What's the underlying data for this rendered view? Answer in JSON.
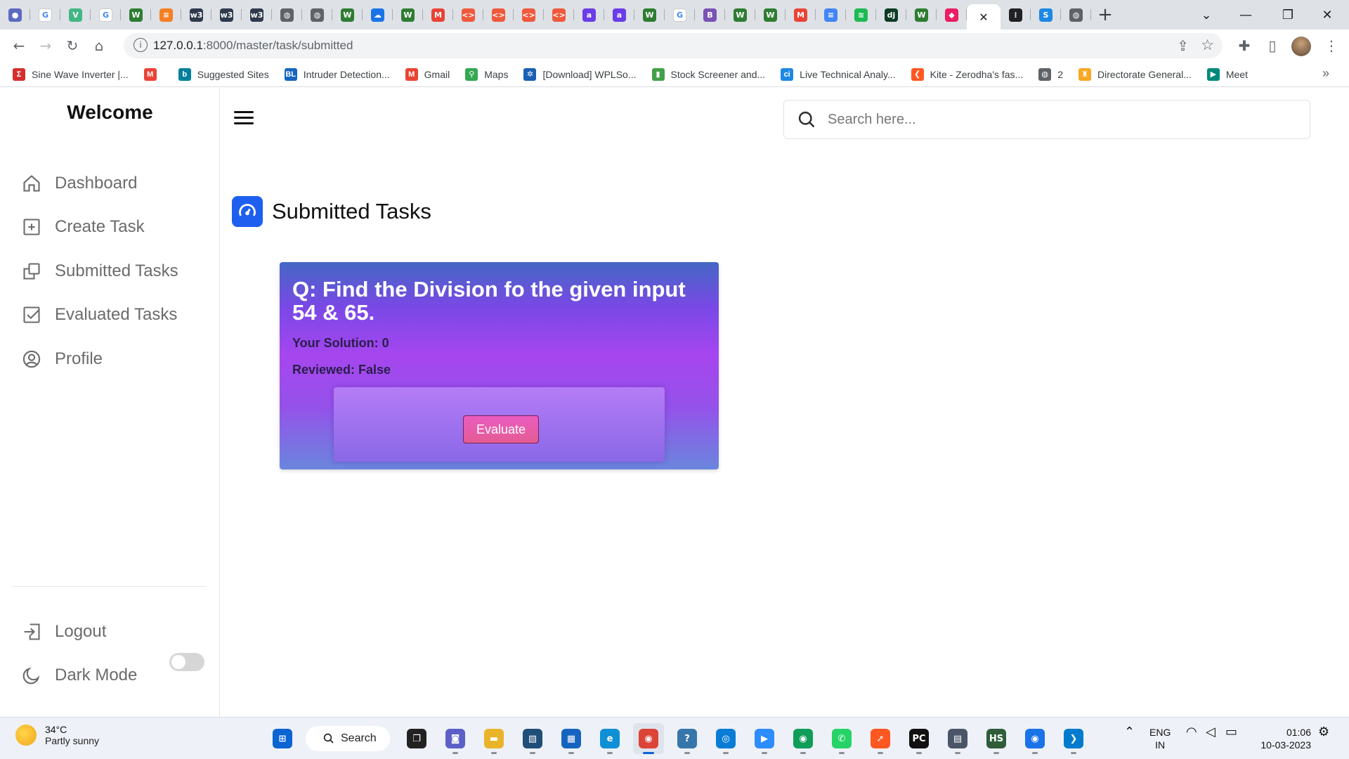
{
  "browser": {
    "url_host": "127.0.0.1",
    "url_rest": ":8000/master/task/submitted",
    "tabs": [
      {
        "icon": "dot",
        "color": "#5c6bc0",
        "glyph": "●"
      },
      {
        "icon": "google-icon",
        "color": "#ffffff",
        "glyph": "G"
      },
      {
        "icon": "vue-icon",
        "color": "#41b883",
        "glyph": "V"
      },
      {
        "icon": "google-icon",
        "color": "#ffffff",
        "glyph": "G"
      },
      {
        "icon": "w-icon",
        "color": "#2e7d32",
        "glyph": "W"
      },
      {
        "icon": "stack-icon",
        "color": "#f48024",
        "glyph": "≡"
      },
      {
        "icon": "w3-icon",
        "color": "#2f3b4c",
        "glyph": "w3"
      },
      {
        "icon": "w3-icon",
        "color": "#2f3b4c",
        "glyph": "w3"
      },
      {
        "icon": "w3-icon",
        "color": "#2f3b4c",
        "glyph": "w3"
      },
      {
        "icon": "globe-icon",
        "color": "#5f6368",
        "glyph": "◍"
      },
      {
        "icon": "globe-icon",
        "color": "#5f6368",
        "glyph": "◍"
      },
      {
        "icon": "w-icon",
        "color": "#2e7d32",
        "glyph": "W"
      },
      {
        "icon": "cloud-icon",
        "color": "#1a73e8",
        "glyph": "☁"
      },
      {
        "icon": "w-icon",
        "color": "#2e7d32",
        "glyph": "W"
      },
      {
        "icon": "gmail-icon",
        "color": "#ea4335",
        "glyph": "M"
      },
      {
        "icon": "code-icon",
        "color": "#ef5a3c",
        "glyph": "<>"
      },
      {
        "icon": "code-icon",
        "color": "#ef5a3c",
        "glyph": "<>"
      },
      {
        "icon": "code-icon",
        "color": "#ef5a3c",
        "glyph": "<>"
      },
      {
        "icon": "code-icon",
        "color": "#ef5a3c",
        "glyph": "<>"
      },
      {
        "icon": "a-icon",
        "color": "#6a3de8",
        "glyph": "a"
      },
      {
        "icon": "a-icon",
        "color": "#6a3de8",
        "glyph": "a"
      },
      {
        "icon": "w-icon",
        "color": "#2e7d32",
        "glyph": "W"
      },
      {
        "icon": "google-icon",
        "color": "#ffffff",
        "glyph": "G"
      },
      {
        "icon": "bootstrap-icon",
        "color": "#7952b3",
        "glyph": "B"
      },
      {
        "icon": "w-icon",
        "color": "#2e7d32",
        "glyph": "W"
      },
      {
        "icon": "w-icon",
        "color": "#2e7d32",
        "glyph": "W"
      },
      {
        "icon": "gmail-icon",
        "color": "#ea4335",
        "glyph": "M"
      },
      {
        "icon": "docs-icon",
        "color": "#4285f4",
        "glyph": "≡"
      },
      {
        "icon": "spotify-icon",
        "color": "#1db954",
        "glyph": "≋"
      },
      {
        "icon": "django-icon",
        "color": "#0c3c26",
        "glyph": "dj"
      },
      {
        "icon": "w-icon",
        "color": "#2e7d32",
        "glyph": "W"
      },
      {
        "icon": "cube-icon",
        "color": "#e91e63",
        "glyph": "◆"
      },
      {
        "icon": "close-icon",
        "color": "#ffffff",
        "glyph": "✕",
        "active": true
      },
      {
        "icon": "dark-icon",
        "color": "#202124",
        "glyph": "⁞"
      },
      {
        "icon": "s-icon",
        "color": "#1e88e5",
        "glyph": "S"
      },
      {
        "icon": "globe-icon",
        "color": "#5f6368",
        "glyph": "◍"
      }
    ],
    "bookmarks": [
      {
        "label": "Sine Wave Inverter |...",
        "color": "#d32f2f",
        "glyph": "Σ"
      },
      {
        "label": "",
        "color": "#ea4335",
        "glyph": "M"
      },
      {
        "label": "Suggested Sites",
        "color": "#00809d",
        "glyph": "b"
      },
      {
        "label": "Intruder Detection...",
        "color": "#1565c0",
        "glyph": "BL"
      },
      {
        "label": "Gmail",
        "color": "#ea4335",
        "glyph": "M"
      },
      {
        "label": "Maps",
        "color": "#34a853",
        "glyph": "⚲"
      },
      {
        "label": "[Download] WPLSo...",
        "color": "#1a5fb4",
        "glyph": "✲"
      },
      {
        "label": "Stock Screener and...",
        "color": "#43a047",
        "glyph": "▮"
      },
      {
        "label": "Live Technical Analy...",
        "color": "#1e88e5",
        "glyph": "ci"
      },
      {
        "label": "Kite - Zerodha's fas...",
        "color": "#ff5722",
        "glyph": "❮"
      },
      {
        "label": "2",
        "color": "#5f6368",
        "glyph": "◍"
      },
      {
        "label": "Directorate General...",
        "color": "#f9a825",
        "glyph": "♜"
      },
      {
        "label": "Meet",
        "color": "#00897b",
        "glyph": "▶"
      }
    ],
    "more_bookmarks": "»"
  },
  "app": {
    "brand": "Welcome",
    "nav": [
      {
        "label": "Dashboard",
        "icon": "home-icon"
      },
      {
        "label": "Create Task",
        "icon": "plus-square-icon"
      },
      {
        "label": "Submitted Tasks",
        "icon": "stack-icon"
      },
      {
        "label": "Evaluated Tasks",
        "icon": "check-square-icon"
      },
      {
        "label": "Profile",
        "icon": "user-circle-icon"
      }
    ],
    "logout": "Logout",
    "dark_mode": "Dark Mode",
    "dark_mode_on": false,
    "search_placeholder": "Search here...",
    "page_title": "Submitted Tasks",
    "card": {
      "question": "Q: Find the Division fo the given input 54 & 65.",
      "solution": "Your Solution: 0",
      "reviewed": "Reviewed: False",
      "button": "Evaluate"
    }
  },
  "taskbar": {
    "temperature": "34°C",
    "weather": "Partly sunny",
    "search": "Search",
    "language_top": "ENG",
    "language_bottom": "IN",
    "time": "01:06",
    "date": "10-03-2023",
    "apps": [
      {
        "name": "start-icon",
        "color": "#0a64d2",
        "glyph": "⊞"
      },
      {
        "name": "task-view-icon",
        "color": "#222222",
        "glyph": "❐"
      },
      {
        "name": "chat-icon",
        "color": "#5b5fc7",
        "glyph": "◙"
      },
      {
        "name": "file-explorer-icon",
        "color": "#e9b42a",
        "glyph": "▬"
      },
      {
        "name": "vmware-icon",
        "color": "#1f4e79",
        "glyph": "▧"
      },
      {
        "name": "store-icon",
        "color": "#1565c0",
        "glyph": "▦"
      },
      {
        "name": "edge-icon",
        "color": "#0f8fd6",
        "glyph": "e"
      },
      {
        "name": "chrome-icon",
        "color": "#db4437",
        "glyph": "◉",
        "active": true
      },
      {
        "name": "python-icon",
        "color": "#3776ab",
        "glyph": "?"
      },
      {
        "name": "app-icon",
        "color": "#0a7cd6",
        "glyph": "◎"
      },
      {
        "name": "zoom-icon",
        "color": "#2d8cff",
        "glyph": "▶"
      },
      {
        "name": "chrome-icon",
        "color": "#0f9d58",
        "glyph": "◉"
      },
      {
        "name": "whatsapp-icon",
        "color": "#25d366",
        "glyph": "✆"
      },
      {
        "name": "compass-icon",
        "color": "#ff5722",
        "glyph": "➚"
      },
      {
        "name": "pycharm-icon",
        "color": "#111111",
        "glyph": "PC"
      },
      {
        "name": "calculator-icon",
        "color": "#4a5568",
        "glyph": "▤"
      },
      {
        "name": "hs-icon",
        "color": "#2f5d3a",
        "glyph": "HS"
      },
      {
        "name": "chrome-icon",
        "color": "#1a73e8",
        "glyph": "◉"
      },
      {
        "name": "vscode-icon",
        "color": "#007acc",
        "glyph": "❯"
      }
    ]
  }
}
